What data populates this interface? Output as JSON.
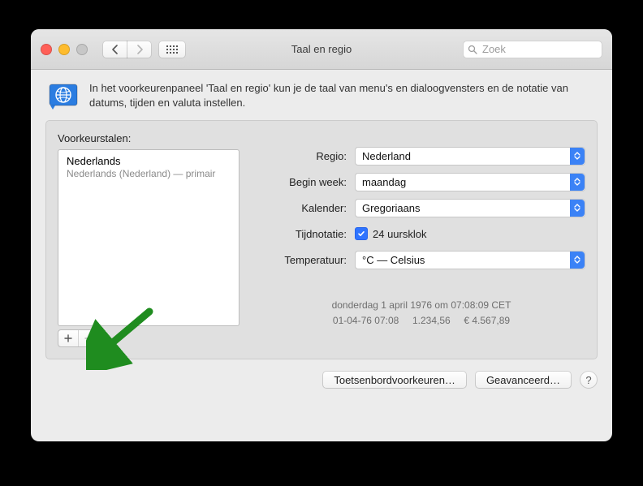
{
  "window": {
    "title": "Taal en regio"
  },
  "search": {
    "placeholder": "Zoek"
  },
  "intro": {
    "text": "In het voorkeurenpaneel 'Taal en regio' kun je de taal van menu's en dialoogvensters en de notatie van datums, tijden en valuta instellen."
  },
  "sidebar": {
    "label": "Voorkeurstalen:",
    "items": [
      {
        "name": "Nederlands",
        "sub": "Nederlands (Nederland) — primair"
      }
    ]
  },
  "settings": {
    "labels": {
      "region": "Regio:",
      "first_day": "Begin week:",
      "calendar": "Kalender:",
      "time_format": "Tijdnotatie:",
      "temperature": "Temperatuur:"
    },
    "values": {
      "region": "Nederland",
      "first_day": "maandag",
      "calendar": "Gregoriaans",
      "time_format_checkbox": "24 uursklok",
      "temperature": "°C — Celsius"
    }
  },
  "examples": {
    "line1": "donderdag 1 april 1976 om 07:08:09 CET",
    "line2": "01-04-76 07:08     1.234,56     € 4.567,89"
  },
  "buttons": {
    "keyboard_prefs": "Toetsenbordvoorkeuren…",
    "advanced": "Geavanceerd…",
    "help": "?"
  }
}
